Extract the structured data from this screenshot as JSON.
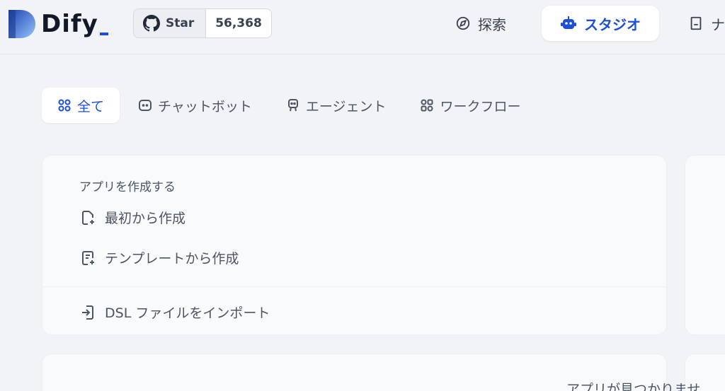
{
  "header": {
    "logo_text": "Dify",
    "github": {
      "star_label": "Star",
      "count": "56,368"
    },
    "nav": {
      "explore": "探索",
      "studio": "スタジオ",
      "knowledge": "ナ"
    }
  },
  "tabs": [
    {
      "label": "全て",
      "active": true
    },
    {
      "label": "チャットボット",
      "active": false
    },
    {
      "label": "エージェント",
      "active": false
    },
    {
      "label": "ワークフロー",
      "active": false
    }
  ],
  "create_card": {
    "title": "アプリを作成する",
    "from_blank": "最初から作成",
    "from_template": "テンプレートから作成",
    "import_dsl": "DSL ファイルをインポート"
  },
  "empty_state": "アプリが見つかりませ",
  "colors": {
    "accent": "#1d4ed8",
    "background": "#f2f3f6"
  }
}
